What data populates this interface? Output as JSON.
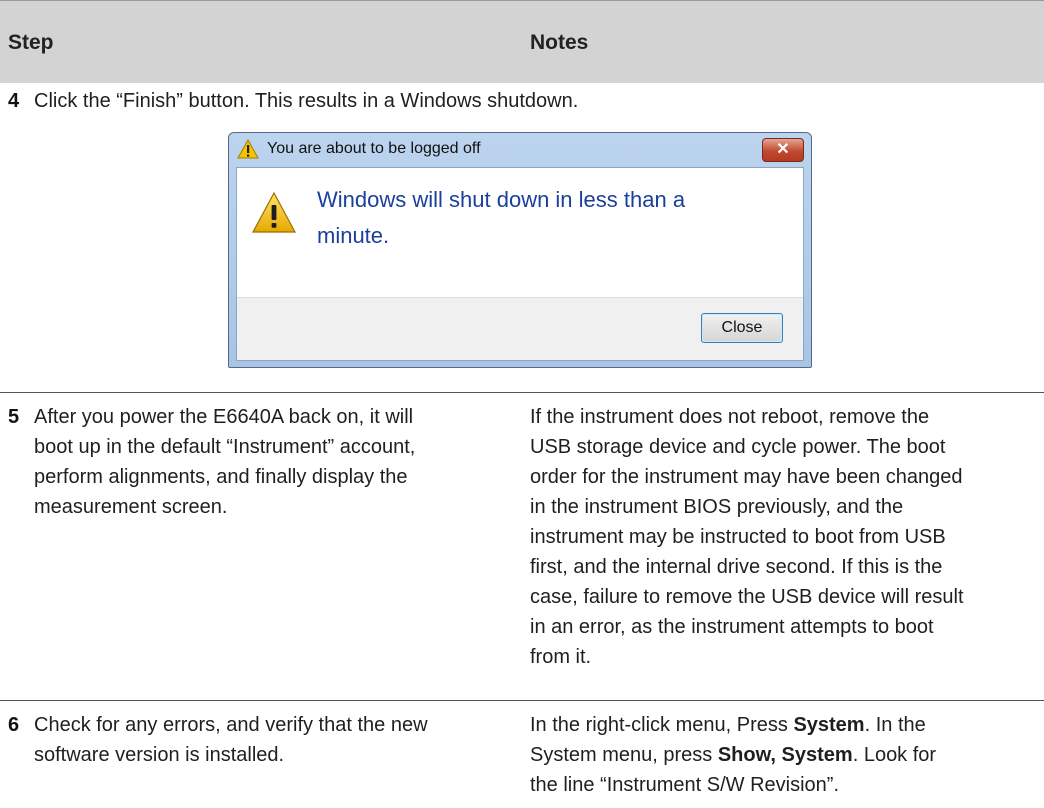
{
  "table": {
    "header": {
      "step": "Step",
      "notes": "Notes"
    },
    "rows": [
      {
        "number": "4",
        "step": "Click the “Finish” button. This results in a Windows shutdown."
      },
      {
        "number": "5",
        "step_lines": [
          "After you power the E6640A back on, it will",
          "boot up in the default “Instrument” account,",
          "perform alignments, and finally display the",
          "measurement screen."
        ],
        "notes_lines": [
          "If the instrument does not reboot, remove the",
          "USB storage device and cycle power. The boot",
          "order for the instrument may have been changed",
          "in the instrument BIOS previously, and the",
          "instrument may be instructed to boot from USB",
          "first, and the internal drive second. If this is the",
          "case, failure to remove the USB device will result",
          "in an error, as the instrument attempts to boot",
          "from it."
        ]
      },
      {
        "number": "6",
        "step_lines": [
          "Check for any errors, and verify that the new",
          "software version is installed."
        ],
        "notes": {
          "l1_pre": "In the right-click menu, Press ",
          "l1_bold": "System",
          "l1_post": ". In the",
          "l2_pre": "System menu, press ",
          "l2_bold": "Show, System",
          "l2_post": ". Look for",
          "l3": "the line “Instrument S/W Revision”."
        }
      }
    ]
  },
  "dialog": {
    "title": "You are about to be logged off",
    "close_glyph": "✕",
    "message_lines": [
      "Windows will shut down in less than a",
      "minute."
    ],
    "button_label": "Close",
    "icon": "warning-icon",
    "colors": {
      "message": "#1b3f9c",
      "titlebar": "#bcd4ee",
      "close_x": "#c24a30"
    }
  }
}
